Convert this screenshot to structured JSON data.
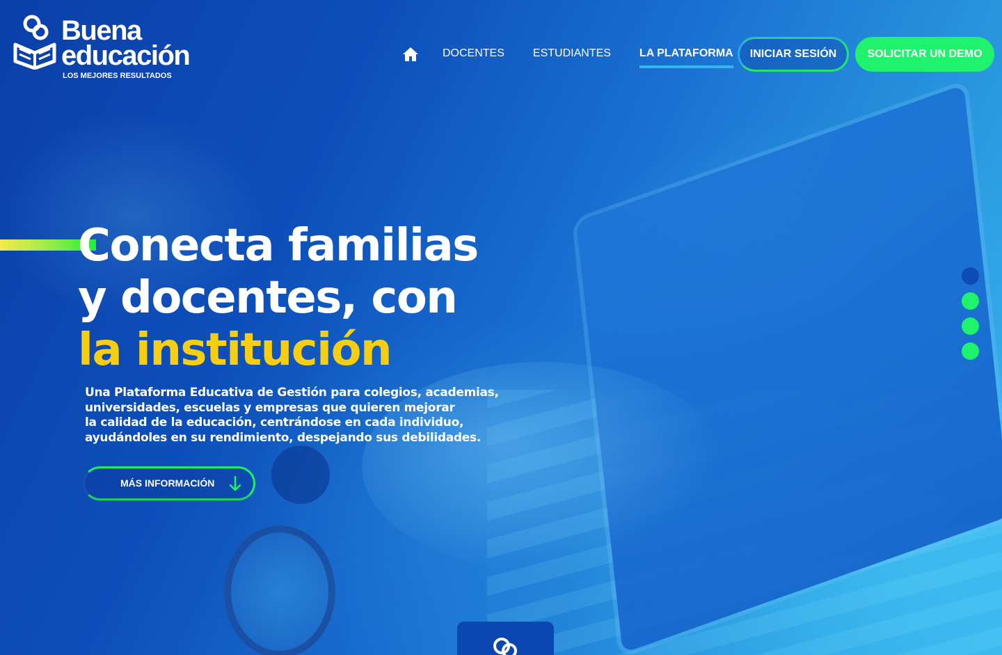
{
  "brand": {
    "name_line1": "Buena",
    "name_line2": "educación",
    "tagline": "LOS MEJORES RESULTADOS"
  },
  "nav": {
    "home_icon": "home-icon",
    "items": [
      {
        "label": "DOCENTES",
        "active": false
      },
      {
        "label": "ESTUDIANTES",
        "active": false
      },
      {
        "label": "LA PLATAFORMA",
        "active": true
      }
    ],
    "login_label": "INICIAR SESIÓN",
    "demo_label": "SOLICITAR UN DEMO"
  },
  "hero": {
    "headline_line1": "Conecta familias",
    "headline_line2": "y docentes, con",
    "headline_line3": "la institución",
    "description_lines": [
      "Una Plataforma Educativa de Gestión para colegios, academias,",
      "universidades, escuelas y empresas que quieren mejorar",
      "la calidad de la educación, centrándose en cada individuo,",
      "ayudándoles en su rendimiento, despejando sus debilidades."
    ],
    "more_button_label": "MÁS INFORMACIÓN",
    "more_button_icon": "arrow-down-icon"
  },
  "slider": {
    "total": 4,
    "active_index": 0
  },
  "colors": {
    "accent_green": "#1ff26c",
    "accent_yellow": "#f7cf10",
    "primary_blue": "#0c4bb8",
    "underline_blue": "#34b5f0"
  }
}
